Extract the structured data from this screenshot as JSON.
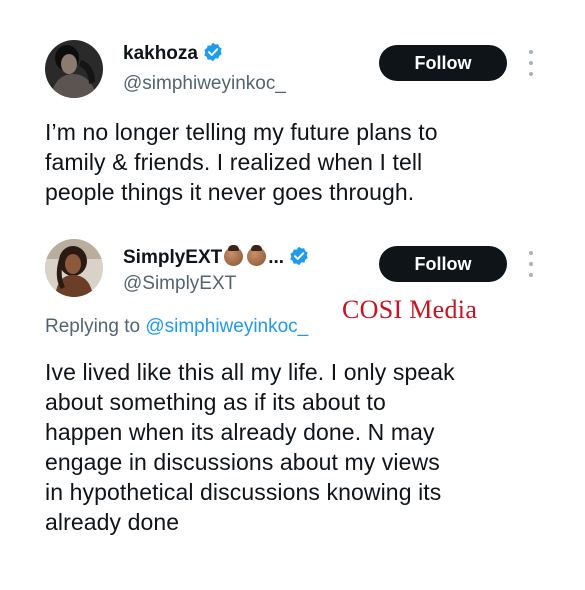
{
  "tweets": [
    {
      "display_name": "kakhoza",
      "handle": "@simphiweyinkoc_",
      "verified": true,
      "follow_label": "Follow",
      "text": "I’m no longer telling my future plans to\nfamily & friends. I realized when I tell\npeople things it never goes through."
    },
    {
      "display_name": "SimplyEXT",
      "name_suffix": "...",
      "name_emojis": [
        "dark-skin-face-emoji",
        "dark-skin-face-emoji"
      ],
      "handle": "@SimplyEXT",
      "verified": true,
      "follow_label": "Follow",
      "reply_prefix": "Replying to",
      "reply_to": "@simphiweyinkoc_",
      "text": "Ive lived like this all my life. I only speak\nabout something as if its about to\nhappen when its already done. N may\nengage in discussions about my views\nin hypothetical discussions knowing its\nalready done"
    }
  ],
  "watermark": "COSI Media",
  "colors": {
    "text_primary": "#0f1419",
    "text_secondary": "#536471",
    "link": "#1d9bf0",
    "verified_badge": "#1d9bf0",
    "follow_button_bg": "#0f1419",
    "follow_button_text": "#ffffff",
    "watermark": "#c9141f"
  }
}
